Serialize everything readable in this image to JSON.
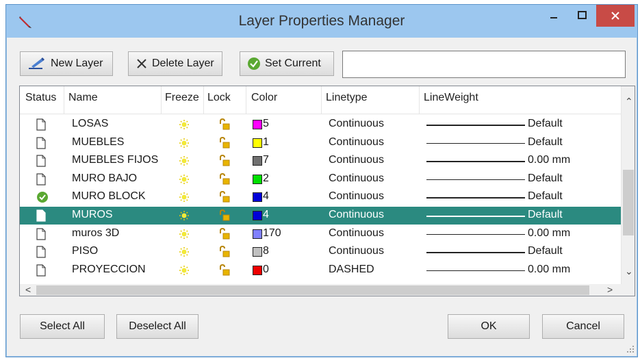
{
  "window": {
    "title": "Layer Properties Manager"
  },
  "toolbar": {
    "new_layer": "New Layer",
    "delete_layer": "Delete Layer",
    "set_current": "Set Current",
    "filter_value": ""
  },
  "columns": {
    "status": "Status",
    "name": "Name",
    "freeze": "Freeze",
    "lock": "Lock",
    "color": "Color",
    "linetype": "Linetype",
    "lineweight": "LineWeight"
  },
  "layers": [
    {
      "status": "page",
      "name": "LOSAS",
      "color_hex": "#ff00ff",
      "color": "5",
      "linetype": "Continuous",
      "lineweight": "Default"
    },
    {
      "status": "page",
      "name": "MUEBLES",
      "color_hex": "#ffff00",
      "color": "1",
      "linetype": "Continuous",
      "lineweight": "Default"
    },
    {
      "status": "page",
      "name": "MUEBLES FIJOS",
      "color_hex": "#707070",
      "color": "7",
      "linetype": "Continuous",
      "lineweight": "0.00 mm"
    },
    {
      "status": "page",
      "name": "MURO BAJO",
      "color_hex": "#00e000",
      "color": "2",
      "linetype": "Continuous",
      "lineweight": "Default"
    },
    {
      "status": "current",
      "name": "MURO BLOCK",
      "color_hex": "#0000d8",
      "color": "4",
      "linetype": "Continuous",
      "lineweight": "Default"
    },
    {
      "status": "page",
      "name": "MUROS",
      "color_hex": "#0000d8",
      "color": "4",
      "linetype": "Continuous",
      "lineweight": "Default",
      "selected": true
    },
    {
      "status": "page",
      "name": "muros 3D",
      "color_hex": "#8080ff",
      "color": "170",
      "linetype": "Continuous",
      "lineweight": "0.00 mm"
    },
    {
      "status": "page",
      "name": "PISO",
      "color_hex": "#c0c0c0",
      "color": "8",
      "linetype": "Continuous",
      "lineweight": "Default"
    },
    {
      "status": "page",
      "name": "PROYECCION",
      "color_hex": "#ee0000",
      "color": "0",
      "linetype": "DASHED",
      "lineweight": "0.00 mm"
    }
  ],
  "buttons": {
    "select_all": "Select All",
    "deselect_all": "Deselect All",
    "ok": "OK",
    "cancel": "Cancel"
  }
}
